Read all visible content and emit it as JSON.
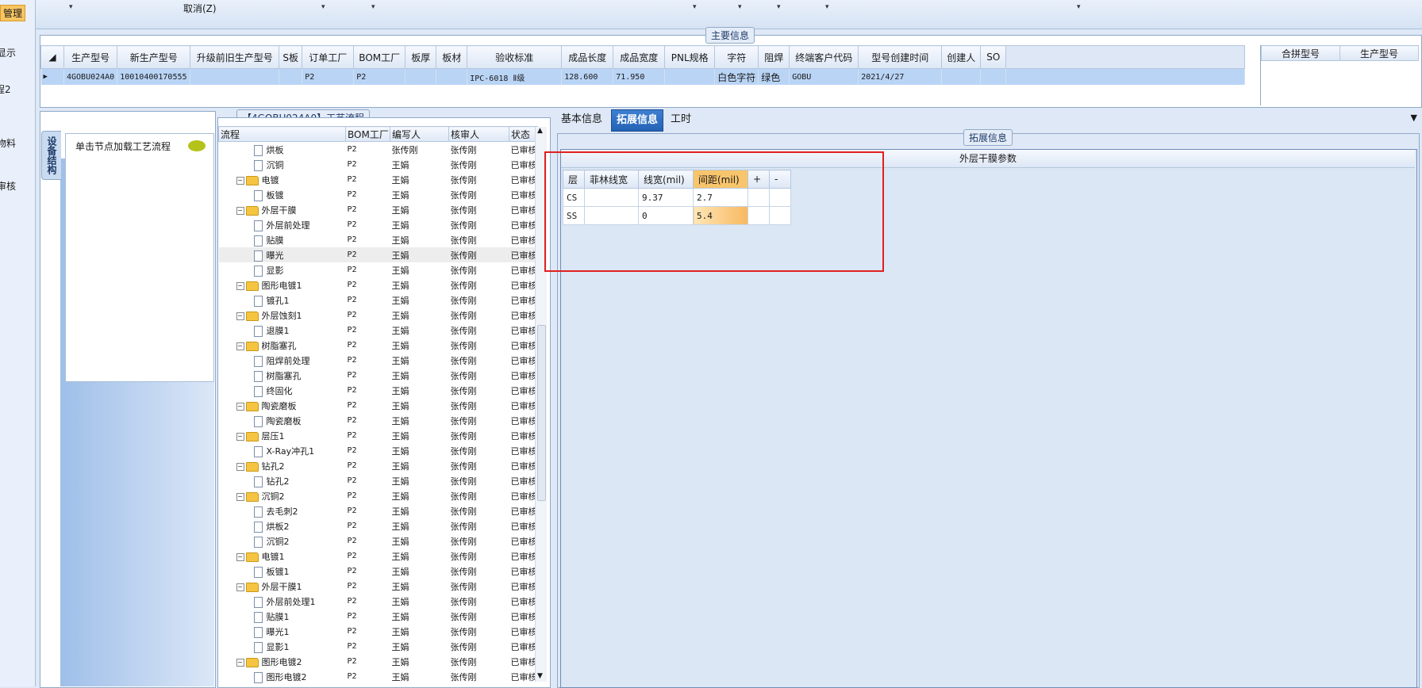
{
  "left_nav": {
    "items": [
      "管理",
      "显示",
      "程2",
      "物料",
      "审核"
    ]
  },
  "top_bar": {
    "cancel_label": "取消(Z)"
  },
  "main_info": {
    "title": "主要信息",
    "columns": [
      "生产型号",
      "新生产型号",
      "升级前旧生产型号",
      "S板",
      "订单工厂",
      "BOM工厂",
      "板厚",
      "板材",
      "验收标准",
      "成品长度",
      "成品宽度",
      "PNL规格",
      "字符",
      "阻焊",
      "终端客户代码",
      "型号创建时间",
      "创建人",
      "SO"
    ],
    "row": [
      "4GOBU024A0",
      "10010400170555",
      "",
      "",
      "P2",
      "P2",
      "",
      "",
      "IPC-6018 Ⅱ级",
      "128.600",
      "71.950",
      "",
      "白色字符",
      "绿色",
      "GOBU",
      "2021/4/27",
      "",
      ""
    ],
    "side_columns": [
      "合拼型号",
      "生产型号"
    ]
  },
  "left_panel": {
    "vertical_tab": "设备结构",
    "hint": "单击节点加载工艺流程"
  },
  "process_tree": {
    "title": "【4GOBU024A0】工艺流程",
    "columns": [
      "流程",
      "BOM工厂",
      "编写人",
      "核审人",
      "状态"
    ],
    "rows": [
      {
        "name": "烘板",
        "type": "doc",
        "bom": "P2",
        "writer": "张传刚",
        "reviewer": "张传刚",
        "status": "已审核"
      },
      {
        "name": "沉铜",
        "type": "doc",
        "bom": "P2",
        "writer": "王娟",
        "reviewer": "张传刚",
        "status": "已审核"
      },
      {
        "name": "电镀",
        "type": "folder",
        "bom": "P2",
        "writer": "王娟",
        "reviewer": "张传刚",
        "status": "已审核"
      },
      {
        "name": "板镀",
        "type": "doc",
        "bom": "P2",
        "writer": "王娟",
        "reviewer": "张传刚",
        "status": "已审核"
      },
      {
        "name": "外层干膜",
        "type": "folder",
        "bom": "P2",
        "writer": "王娟",
        "reviewer": "张传刚",
        "status": "已审核"
      },
      {
        "name": "外层前处理",
        "type": "doc",
        "bom": "P2",
        "writer": "王娟",
        "reviewer": "张传刚",
        "status": "已审核"
      },
      {
        "name": "贴膜",
        "type": "doc",
        "bom": "P2",
        "writer": "王娟",
        "reviewer": "张传刚",
        "status": "已审核"
      },
      {
        "name": "曝光",
        "type": "doc",
        "bom": "P2",
        "writer": "王娟",
        "reviewer": "张传刚",
        "status": "已审核"
      },
      {
        "name": "显影",
        "type": "doc",
        "bom": "P2",
        "writer": "王娟",
        "reviewer": "张传刚",
        "status": "已审核"
      },
      {
        "name": "图形电镀1",
        "type": "folder",
        "bom": "P2",
        "writer": "王娟",
        "reviewer": "张传刚",
        "status": "已审核"
      },
      {
        "name": "镀孔1",
        "type": "doc",
        "bom": "P2",
        "writer": "王娟",
        "reviewer": "张传刚",
        "status": "已审核"
      },
      {
        "name": "外层蚀刻1",
        "type": "folder",
        "bom": "P2",
        "writer": "王娟",
        "reviewer": "张传刚",
        "status": "已审核"
      },
      {
        "name": "退膜1",
        "type": "doc",
        "bom": "P2",
        "writer": "王娟",
        "reviewer": "张传刚",
        "status": "已审核"
      },
      {
        "name": "树脂塞孔",
        "type": "folder",
        "bom": "P2",
        "writer": "王娟",
        "reviewer": "张传刚",
        "status": "已审核"
      },
      {
        "name": "阻焊前处理",
        "type": "doc",
        "bom": "P2",
        "writer": "王娟",
        "reviewer": "张传刚",
        "status": "已审核"
      },
      {
        "name": "树脂塞孔",
        "type": "doc",
        "bom": "P2",
        "writer": "王娟",
        "reviewer": "张传刚",
        "status": "已审核"
      },
      {
        "name": "终固化",
        "type": "doc",
        "bom": "P2",
        "writer": "王娟",
        "reviewer": "张传刚",
        "status": "已审核"
      },
      {
        "name": "陶瓷磨板",
        "type": "folder",
        "bom": "P2",
        "writer": "王娟",
        "reviewer": "张传刚",
        "status": "已审核"
      },
      {
        "name": "陶瓷磨板",
        "type": "doc",
        "bom": "P2",
        "writer": "王娟",
        "reviewer": "张传刚",
        "status": "已审核"
      },
      {
        "name": "层压1",
        "type": "folder",
        "bom": "P2",
        "writer": "王娟",
        "reviewer": "张传刚",
        "status": "已审核"
      },
      {
        "name": "X-Ray冲孔1",
        "type": "doc",
        "bom": "P2",
        "writer": "王娟",
        "reviewer": "张传刚",
        "status": "已审核"
      },
      {
        "name": "钻孔2",
        "type": "folder",
        "bom": "P2",
        "writer": "王娟",
        "reviewer": "张传刚",
        "status": "已审核"
      },
      {
        "name": "钻孔2",
        "type": "doc",
        "bom": "P2",
        "writer": "王娟",
        "reviewer": "张传刚",
        "status": "已审核"
      },
      {
        "name": "沉铜2",
        "type": "folder",
        "bom": "P2",
        "writer": "王娟",
        "reviewer": "张传刚",
        "status": "已审核"
      },
      {
        "name": "去毛刺2",
        "type": "doc",
        "bom": "P2",
        "writer": "王娟",
        "reviewer": "张传刚",
        "status": "已审核"
      },
      {
        "name": "烘板2",
        "type": "doc",
        "bom": "P2",
        "writer": "王娟",
        "reviewer": "张传刚",
        "status": "已审核"
      },
      {
        "name": "沉铜2",
        "type": "doc",
        "bom": "P2",
        "writer": "王娟",
        "reviewer": "张传刚",
        "status": "已审核"
      },
      {
        "name": "电镀1",
        "type": "folder",
        "bom": "P2",
        "writer": "王娟",
        "reviewer": "张传刚",
        "status": "已审核"
      },
      {
        "name": "板镀1",
        "type": "doc",
        "bom": "P2",
        "writer": "王娟",
        "reviewer": "张传刚",
        "status": "已审核"
      },
      {
        "name": "外层干膜1",
        "type": "folder",
        "bom": "P2",
        "writer": "王娟",
        "reviewer": "张传刚",
        "status": "已审核"
      },
      {
        "name": "外层前处理1",
        "type": "doc",
        "bom": "P2",
        "writer": "王娟",
        "reviewer": "张传刚",
        "status": "已审核"
      },
      {
        "name": "贴膜1",
        "type": "doc",
        "bom": "P2",
        "writer": "王娟",
        "reviewer": "张传刚",
        "status": "已审核"
      },
      {
        "name": "曝光1",
        "type": "doc",
        "bom": "P2",
        "writer": "王娟",
        "reviewer": "张传刚",
        "status": "已审核"
      },
      {
        "name": "显影1",
        "type": "doc",
        "bom": "P2",
        "writer": "王娟",
        "reviewer": "张传刚",
        "status": "已审核"
      },
      {
        "name": "图形电镀2",
        "type": "folder",
        "bom": "P2",
        "writer": "王娟",
        "reviewer": "张传刚",
        "status": "已审核"
      },
      {
        "name": "图形电镀2",
        "type": "doc",
        "bom": "P2",
        "writer": "王娟",
        "reviewer": "张传刚",
        "status": "已审核"
      }
    ]
  },
  "right_panel": {
    "tabs": [
      "基本信息",
      "拓展信息",
      "工时"
    ],
    "active_tab": "拓展信息",
    "group_title": "拓展信息",
    "section_title": "外层干膜参数",
    "param_columns": [
      "层",
      "菲林线宽",
      "线宽(mil)",
      "间距(mil)",
      "+",
      "-"
    ],
    "param_rows": [
      [
        "CS",
        "",
        "9.37",
        "2.7",
        "",
        ""
      ],
      [
        "SS",
        "",
        "0",
        "5.4",
        "",
        ""
      ]
    ]
  },
  "colors": {
    "accent": "#2462b5",
    "highlight": "#f8c56c",
    "annotation": "#e02020",
    "selected_row": "#b9d4f5"
  }
}
